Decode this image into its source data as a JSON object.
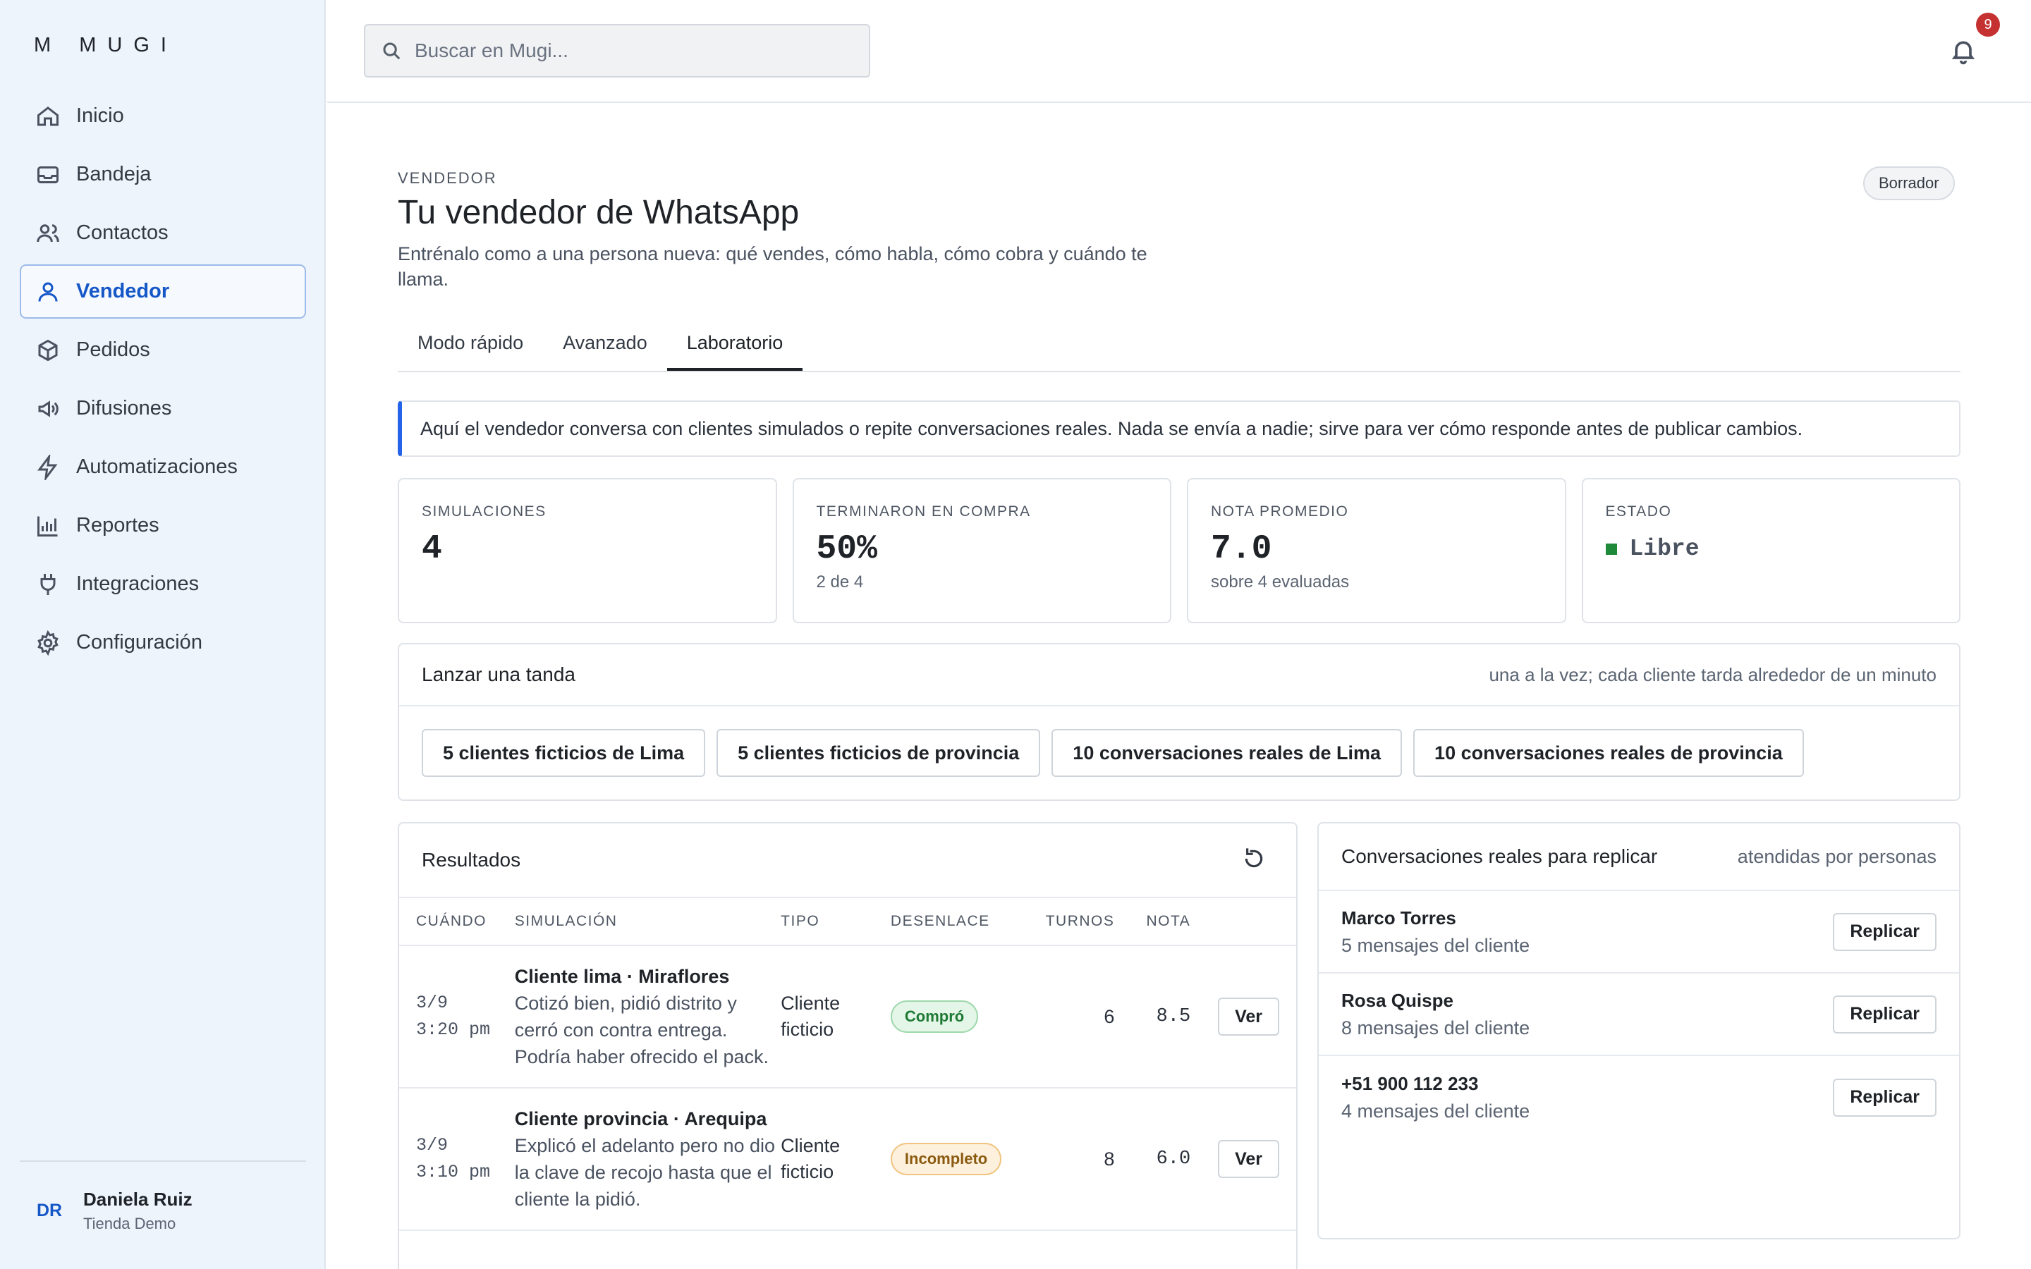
{
  "brand": "M   MUGI",
  "sidebar": {
    "items": [
      {
        "label": "Inicio",
        "icon": "home-icon"
      },
      {
        "label": "Bandeja",
        "icon": "inbox-icon"
      },
      {
        "label": "Contactos",
        "icon": "users-icon"
      },
      {
        "label": "Vendedor",
        "icon": "user-icon",
        "active": true
      },
      {
        "label": "Pedidos",
        "icon": "box-icon"
      },
      {
        "label": "Difusiones",
        "icon": "megaphone-icon"
      },
      {
        "label": "Automatizaciones",
        "icon": "bolt-icon"
      },
      {
        "label": "Reportes",
        "icon": "bar-chart-icon"
      },
      {
        "label": "Integraciones",
        "icon": "plug-icon"
      },
      {
        "label": "Configuración",
        "icon": "gear-icon"
      }
    ],
    "user": {
      "initials": "DR",
      "name": "Daniela Ruiz",
      "store": "Tienda Demo"
    }
  },
  "topbar": {
    "search_placeholder": "Buscar en Mugi...",
    "notifications": "9"
  },
  "page": {
    "eyebrow": "VENDEDOR",
    "title": "Tu vendedor de WhatsApp",
    "subtitle": "Entrénalo como a una persona nueva: qué vendes, cómo habla, cómo cobra y cuándo te llama.",
    "status": "Borrador"
  },
  "tabs": [
    {
      "label": "Modo rápido"
    },
    {
      "label": "Avanzado"
    },
    {
      "label": "Laboratorio",
      "active": true
    }
  ],
  "info": "Aquí el vendedor conversa con clientes simulados o repite conversaciones reales. Nada se envía a nadie; sirve para ver cómo responde antes de publicar cambios.",
  "stats": {
    "simulations": {
      "label": "SIMULACIONES",
      "value": "4"
    },
    "purchases": {
      "label": "TERMINARON EN COMPRA",
      "value": "50%",
      "sub": "2 de 4"
    },
    "avg": {
      "label": "NOTA PROMEDIO",
      "value": "7.0",
      "sub": "sobre 4 evaluadas"
    },
    "state": {
      "label": "ESTADO",
      "value": "Libre",
      "color": "#1e8a3a"
    }
  },
  "batch": {
    "title": "Lanzar una tanda",
    "note": "una a la vez; cada cliente tarda alrededor de un minuto",
    "buttons": [
      "5 clientes ficticios de Lima",
      "5 clientes ficticios de provincia",
      "10 conversaciones reales de Lima",
      "10 conversaciones reales de provincia"
    ]
  },
  "results": {
    "title": "Resultados",
    "columns": {
      "when": "CUÁNDO",
      "sim": "SIMULACIÓN",
      "type": "TIPO",
      "outcome": "DESENLACE",
      "turns": "TURNOS",
      "note": "NOTA"
    },
    "rows": [
      {
        "date": "3/9",
        "time": "3:20 pm",
        "title": "Cliente lima · Miraflores",
        "desc": "Cotizó bien, pidió distrito y cerró con contra entrega. Podría haber ofrecido el pack.",
        "type": "Cliente ficticio",
        "outcome": "Compró",
        "turns": "6",
        "note": "8.5",
        "action": "Ver"
      },
      {
        "date": "3/9",
        "time": "3:10 pm",
        "title": "Cliente provincia · Arequipa",
        "desc": "Explicó el adelanto pero no dio la clave de recojo hasta que el cliente la pidió.",
        "type": "Cliente ficticio",
        "outcome": "Incompleto",
        "turns": "8",
        "note": "6.0",
        "action": "Ver"
      }
    ]
  },
  "real": {
    "title": "Conversaciones reales para replicar",
    "note": "atendidas por personas",
    "items": [
      {
        "name": "Marco Torres",
        "sub": "5 mensajes del cliente",
        "action": "Replicar"
      },
      {
        "name": "Rosa Quispe",
        "sub": "8 mensajes del cliente",
        "action": "Replicar"
      },
      {
        "name": "+51 900 112 233",
        "sub": "4 mensajes del cliente",
        "action": "Replicar"
      }
    ]
  }
}
